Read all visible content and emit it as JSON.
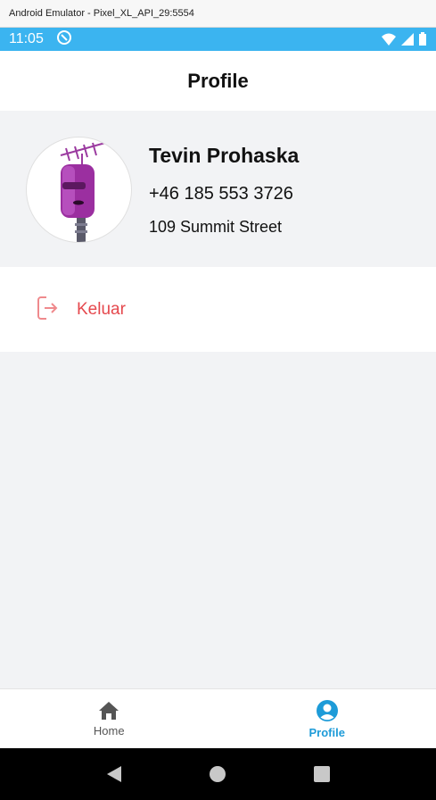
{
  "window": {
    "title": "Android Emulator - Pixel_XL_API_29:5554"
  },
  "status_bar": {
    "time": "11:05",
    "color": "#3bb4f0"
  },
  "header": {
    "title": "Profile"
  },
  "profile": {
    "name": "Tevin Prohaska",
    "phone": "+46 185 553 3726",
    "address": "109 Summit Street"
  },
  "actions": {
    "logout_label": "Keluar",
    "logout_color": "#e5484d"
  },
  "bottom_nav": {
    "items": [
      {
        "label": "Home",
        "icon": "home-icon",
        "active": false
      },
      {
        "label": "Profile",
        "icon": "user-circle-icon",
        "active": true
      }
    ],
    "active_color": "#1d9bd8"
  },
  "system_nav": {
    "buttons": [
      "back-icon",
      "home-circle-icon",
      "recents-icon"
    ]
  }
}
